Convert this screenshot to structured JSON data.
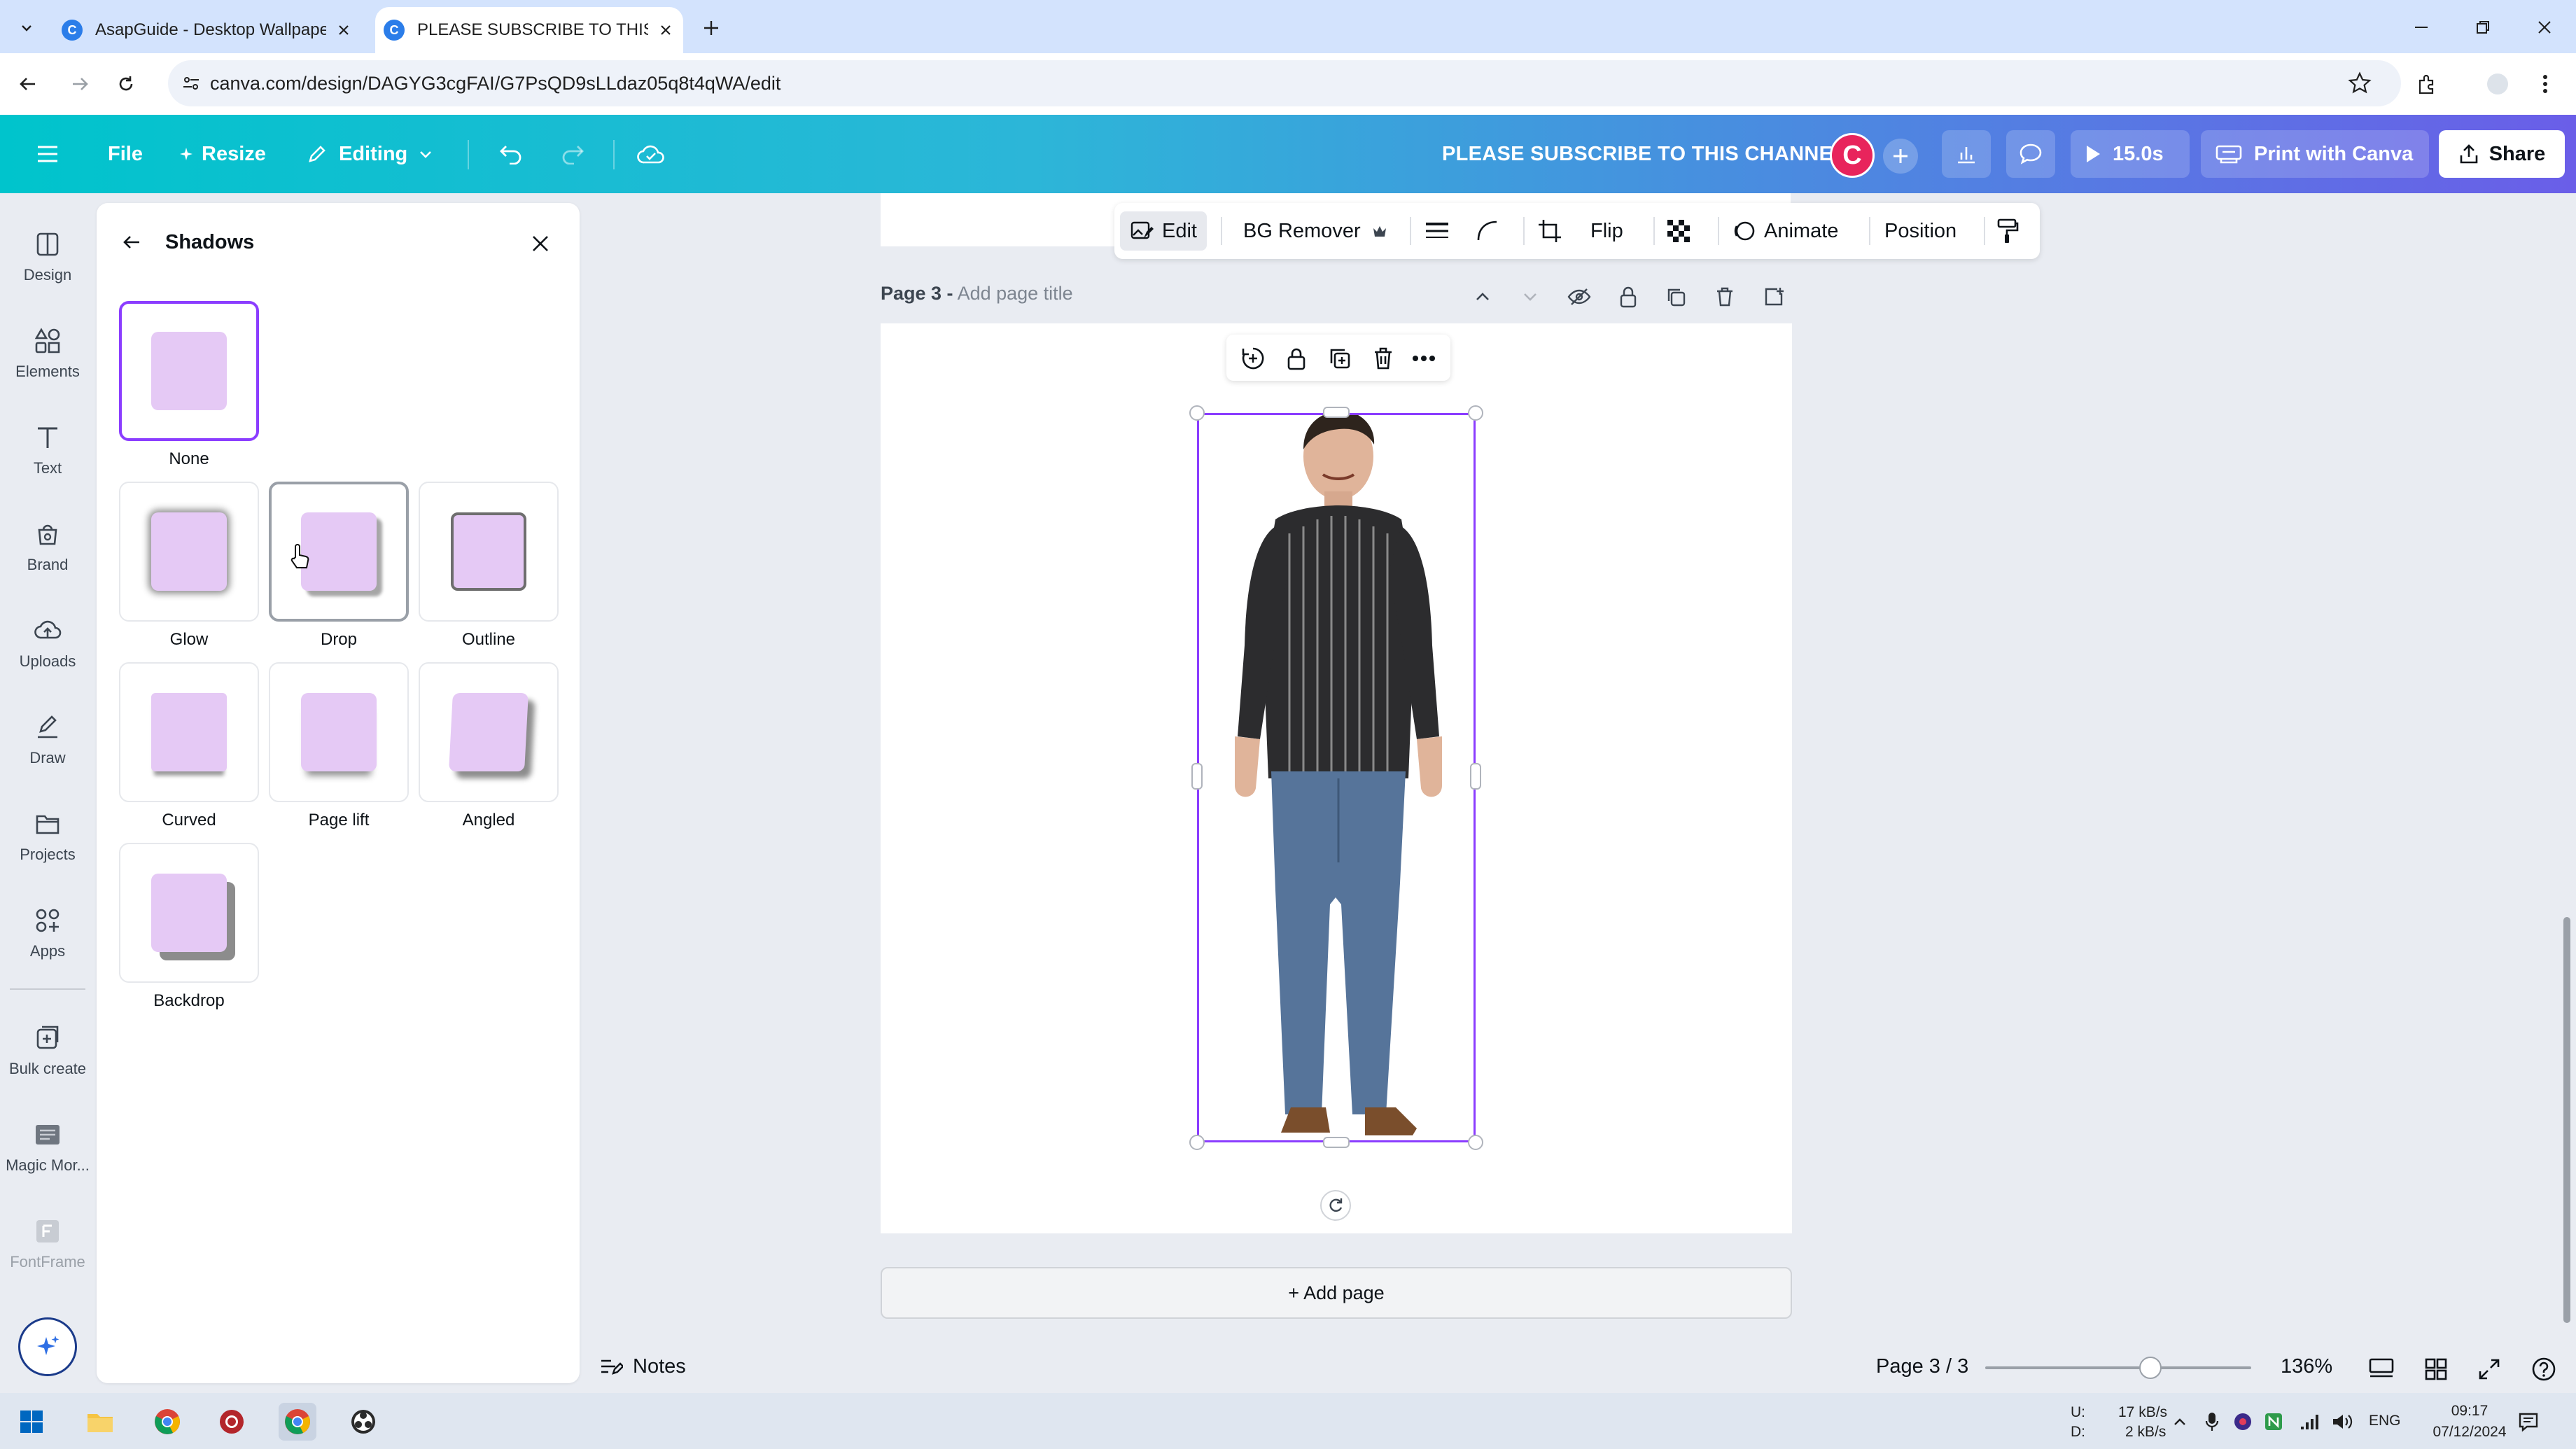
{
  "browser": {
    "tabs": [
      {
        "title": "AsapGuide - Desktop Wallpape",
        "active": false
      },
      {
        "title": "PLEASE SUBSCRIBE TO THIS CH",
        "active": true
      }
    ],
    "url": "canva.com/design/DAGYG3cgFAI/G7PsQD9sLLdaz05q8t4qWA/edit"
  },
  "header": {
    "file_label": "File",
    "resize_label": "Resize",
    "editing_label": "Editing",
    "doc_title": "PLEASE SUBSCRIBE TO THIS CHANNEL",
    "avatar_letter": "C",
    "play_label": "15.0s",
    "print_label": "Print with Canva",
    "share_label": "Share"
  },
  "rail": {
    "items": [
      {
        "label": "Design",
        "icon": "design-icon"
      },
      {
        "label": "Elements",
        "icon": "elements-icon"
      },
      {
        "label": "Text",
        "icon": "text-icon"
      },
      {
        "label": "Brand",
        "icon": "brand-icon"
      },
      {
        "label": "Uploads",
        "icon": "uploads-icon"
      },
      {
        "label": "Draw",
        "icon": "draw-icon"
      },
      {
        "label": "Projects",
        "icon": "projects-icon"
      },
      {
        "label": "Apps",
        "icon": "apps-icon"
      },
      {
        "label": "Bulk create",
        "icon": "bulk-create-icon"
      },
      {
        "label": "Magic Mor...",
        "icon": "magic-morph-icon"
      },
      {
        "label": "FontFrame",
        "icon": "fontframe-icon"
      }
    ]
  },
  "panel": {
    "title": "Shadows",
    "options": [
      {
        "label": "None",
        "selected": true
      },
      {
        "label": "Glow",
        "selected": false
      },
      {
        "label": "Drop",
        "selected": false
      },
      {
        "label": "Outline",
        "selected": false
      },
      {
        "label": "Curved",
        "selected": false
      },
      {
        "label": "Page lift",
        "selected": false
      },
      {
        "label": "Angled",
        "selected": false
      },
      {
        "label": "Backdrop",
        "selected": false
      }
    ]
  },
  "toolbar": {
    "edit_label": "Edit",
    "bg_remover_label": "BG Remover",
    "flip_label": "Flip",
    "animate_label": "Animate",
    "position_label": "Position"
  },
  "canvas": {
    "page_number": "Page 3 -",
    "page_title_placeholder": "Add page title",
    "add_page_label": "+ Add page"
  },
  "footer": {
    "notes_label": "Notes",
    "page_indicator": "Page 3 / 3",
    "zoom": "136%",
    "zoom_fraction": 0.62
  },
  "taskbar": {
    "net_up_label": "U:",
    "net_down_label": "D:",
    "net_up": "17 kB/s",
    "net_down": "2 kB/s",
    "lang": "ENG",
    "time": "09:17",
    "date": "07/12/2024"
  },
  "colors": {
    "accent": "#8b3dff",
    "header_start": "#00c4cc",
    "header_end": "#6a5ee8",
    "swatch": "#e5c9f5"
  }
}
